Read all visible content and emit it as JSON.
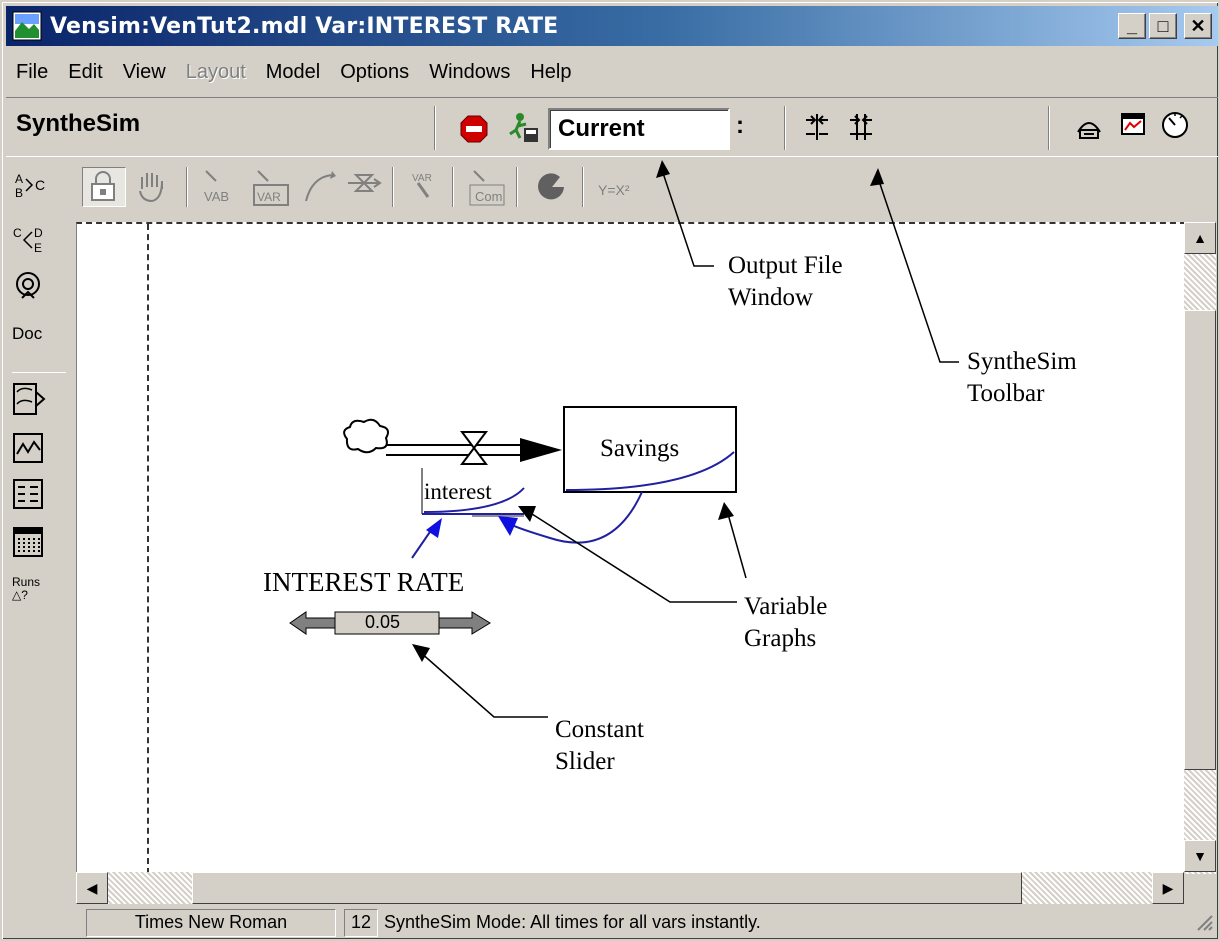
{
  "window": {
    "title": "Vensim:VenTut2.mdl Var:INTEREST RATE",
    "minimize": "_",
    "maximize": "□",
    "close": "✕"
  },
  "menu": {
    "items": [
      {
        "label": "File"
      },
      {
        "label": "Edit"
      },
      {
        "label": "View"
      },
      {
        "label": "Layout"
      },
      {
        "label": "Model"
      },
      {
        "label": "Options"
      },
      {
        "label": "Windows"
      },
      {
        "label": "Help"
      }
    ]
  },
  "synthesim_toolbar": {
    "label": "SyntheSim",
    "output_file": "Current",
    "colon": ":"
  },
  "drawing_toolbar": {
    "lock": "🔒",
    "hand": "✋",
    "var_label": "VAR",
    "com_label": "Com",
    "equation_label": "Y=X²"
  },
  "left_tools": {
    "tool1": "A▷C B",
    "tool2": "C◁D E",
    "tool3": "⊛",
    "doc": "Doc",
    "runs": "Runs △?"
  },
  "model": {
    "stock_name": "Savings",
    "flow_name": "interest",
    "constant_name": "INTEREST RATE",
    "constant_value": "0.05"
  },
  "annotations": {
    "output_file_window": "Output File\nWindow",
    "synthesim_toolbar": "SyntheSim\nToolbar",
    "variable_graphs": "Variable\nGraphs",
    "constant_slider": "Constant\nSlider"
  },
  "statusbar": {
    "font": "Times New Roman",
    "size": "12",
    "message": "SyntheSim Mode: All times for all vars instantly."
  },
  "colors": {
    "title_start": "#0a246a",
    "title_end": "#a6caf0",
    "graph_line": "#2020a0",
    "arrow_blue": "#1010e0",
    "chrome": "#d4d0c8"
  }
}
